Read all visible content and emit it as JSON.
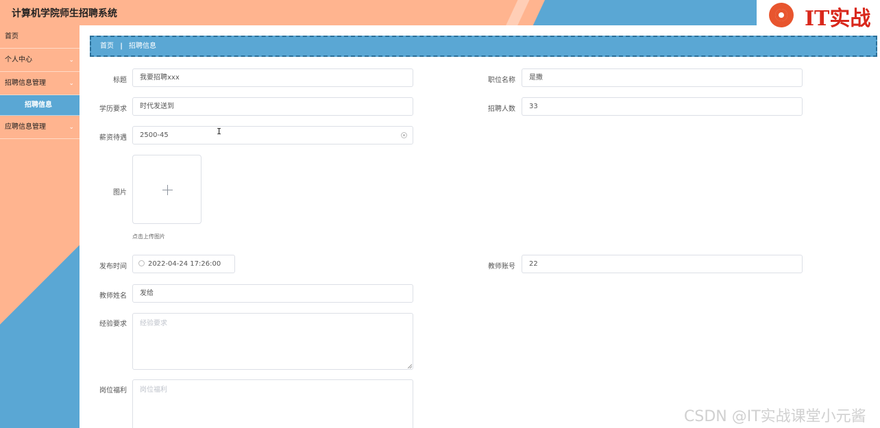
{
  "app": {
    "title": "计算机学院师生招聘系统",
    "logo_text": "IT实战"
  },
  "sidebar": {
    "items": [
      {
        "label": "首页"
      },
      {
        "label": "个人中心",
        "chevron": "⌄"
      },
      {
        "label": "招聘信息管理",
        "chevron": "⌄"
      },
      {
        "label": "招聘信息"
      },
      {
        "label": "应聘信息管理",
        "chevron": "⌄"
      }
    ]
  },
  "breadcrumb": {
    "home": "首页",
    "separator": "|",
    "current": "招聘信息"
  },
  "form": {
    "title": {
      "label": "标题",
      "value": "我要招聘xxx"
    },
    "position": {
      "label": "职位名称",
      "value": "是撒"
    },
    "education": {
      "label": "学历要求",
      "value": "时代发送到"
    },
    "headcount": {
      "label": "招聘人数",
      "value": "33"
    },
    "salary": {
      "label": "薪资待遇",
      "value": "2500-45"
    },
    "image": {
      "label": "图片",
      "hint": "点击上传图片"
    },
    "publish_time": {
      "label": "发布时间",
      "value": "2022-04-24 17:26:00"
    },
    "teacher_account": {
      "label": "教师账号",
      "value": "22"
    },
    "teacher_name": {
      "label": "教师姓名",
      "value": "发给"
    },
    "experience": {
      "label": "经验要求",
      "placeholder": "经验要求"
    },
    "benefits": {
      "label": "岗位福利",
      "placeholder": "岗位福利"
    }
  },
  "watermark": "CSDN @IT实战课堂小元酱",
  "colors": {
    "header_orange": "#ffb48f",
    "header_blue": "#5aa7d4",
    "logo_red": "#d9281c"
  }
}
